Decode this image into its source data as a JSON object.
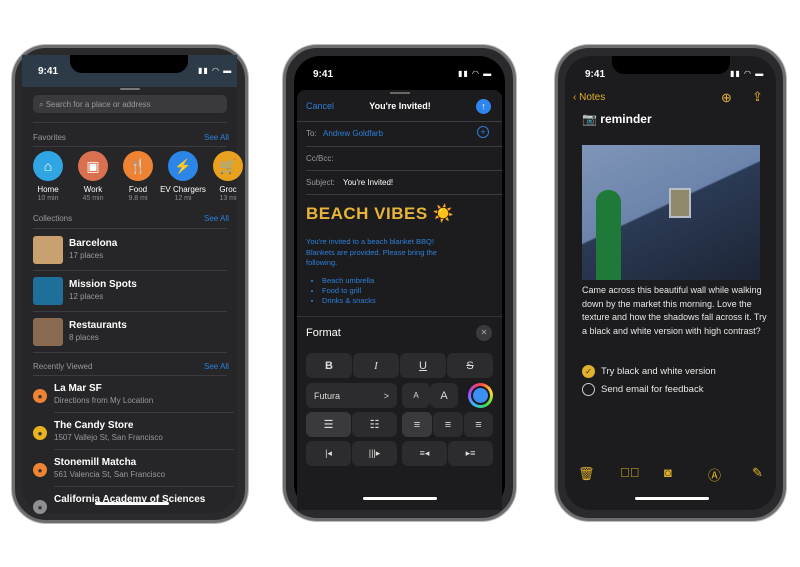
{
  "maps": {
    "time": "9:41",
    "search_placeholder": "Search for a place or address",
    "favorites_label": "Favorites",
    "see_all": "See All",
    "favorites": [
      {
        "label": "Home",
        "sub": "10 min",
        "color": "#2fa5e3",
        "icon": "house-icon"
      },
      {
        "label": "Work",
        "sub": "45 min",
        "color": "#d9704f",
        "icon": "briefcase-icon"
      },
      {
        "label": "Food",
        "sub": "9.8 mi",
        "color": "#ee8433",
        "icon": "fork-knife-icon"
      },
      {
        "label": "EV Chargers",
        "sub": "12 mi",
        "color": "#2b86e8",
        "icon": "plug-icon"
      },
      {
        "label": "Groc",
        "sub": "13 mi",
        "color": "#e9a21f",
        "icon": "cart-icon"
      }
    ],
    "collections_label": "Collections",
    "collections": [
      {
        "title": "Barcelona",
        "sub": "17 places"
      },
      {
        "title": "Mission Spots",
        "sub": "12 places"
      },
      {
        "title": "Restaurants",
        "sub": "8 places"
      }
    ],
    "recent_label": "Recently Viewed",
    "recent": [
      {
        "title": "La Mar SF",
        "sub": "Directions from My Location",
        "color": "#ee8433"
      },
      {
        "title": "The Candy Store",
        "sub": "1507 Vallejo St, San Francisco",
        "color": "#e9b21f"
      },
      {
        "title": "Stonemill Matcha",
        "sub": "561 Valencia St, San Francisco",
        "color": "#ee8433"
      },
      {
        "title": "California Academy of Sciences",
        "sub": "",
        "color": "#8e8e93"
      }
    ]
  },
  "mail": {
    "time": "9:41",
    "cancel": "Cancel",
    "title": "You're Invited!",
    "to_label": "To:",
    "to_value": "Andrew Goldfarb",
    "cc_label": "Cc/Bcc:",
    "subject_label": "Subject:",
    "subject_value": "You're Invited!",
    "heading": "BEACH VIBES ☀️",
    "body": "You're invited to a beach blanket BBQ! Blankets are provided. Please bring the following.",
    "items": [
      "Beach umbrella",
      "Food to grill",
      "Drinks & snacks"
    ],
    "format": {
      "title": "Format",
      "close": "✕",
      "bold": "B",
      "italic": "I",
      "underline": "U",
      "strike": "S",
      "font": "Futura",
      "font_chevron": ">",
      "smaller": "A",
      "larger": "A",
      "color": "#3b8ff0"
    }
  },
  "notes": {
    "time": "9:41",
    "back": "Notes",
    "title": "reminder",
    "body": "Came across this beautiful wall while walking down by the market this morning. Love the texture and how the shadows fall across it. Try a black and white version with high contrast?",
    "checklist": [
      {
        "text": "Try black and white version",
        "checked": true
      },
      {
        "text": "Send email for feedback",
        "checked": false
      }
    ],
    "accent": "#e2b22c"
  }
}
